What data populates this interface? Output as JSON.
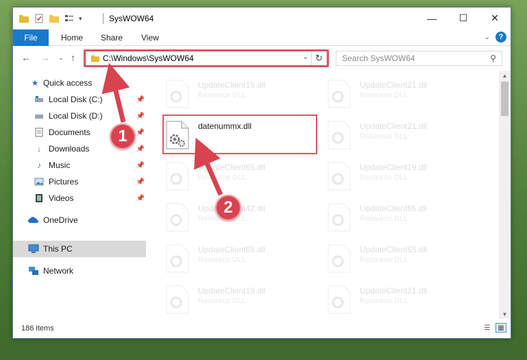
{
  "window": {
    "title": "SysWOW64",
    "controls": {
      "minimize": "—",
      "maximize": "☐",
      "close": "✕"
    }
  },
  "ribbon": {
    "tabs": [
      "File",
      "Home",
      "Share",
      "View"
    ]
  },
  "address": {
    "path": "C:\\Windows\\SysWOW64",
    "search_placeholder": "Search SysWOW64"
  },
  "navpane": {
    "items": [
      {
        "label": "Quick access",
        "icon": "star-icon"
      },
      {
        "label": "Local Disk (C:)",
        "icon": "drive-icon",
        "pinned": true
      },
      {
        "label": "Local Disk (D:)",
        "icon": "drive-icon",
        "pinned": true
      },
      {
        "label": "Documents",
        "icon": "documents-icon",
        "pinned": true
      },
      {
        "label": "Downloads",
        "icon": "download-icon",
        "pinned": true
      },
      {
        "label": "Music",
        "icon": "music-icon",
        "pinned": true
      },
      {
        "label": "Pictures",
        "icon": "pictures-icon",
        "pinned": true
      },
      {
        "label": "Videos",
        "icon": "videos-icon",
        "pinned": true
      },
      {
        "label": "OneDrive",
        "icon": "cloud-icon"
      },
      {
        "label": "This PC",
        "icon": "computer-icon",
        "selected": true
      },
      {
        "label": "Network",
        "icon": "network-icon"
      }
    ]
  },
  "files": {
    "highlighted": {
      "name": "datenummx.dll"
    },
    "faded": [
      {
        "name": "UpdateClient19.dll",
        "type": "Resource DLL"
      },
      {
        "name": "UpdateClient21.dll",
        "type": "Resource DLL"
      },
      {
        "name": "UpdateClient21.dll",
        "type": "Resource DLL"
      },
      {
        "name": "UpdateClient65.dll",
        "type": "Resource DLL"
      },
      {
        "name": "UpdateClient19.dll",
        "type": "Resource DLL"
      },
      {
        "name": "UpdateClient42.dll",
        "type": "Resource DLL"
      },
      {
        "name": "UpdateClient65.dll",
        "type": "Resource DLL"
      },
      {
        "name": "UpdateClient65.dll",
        "type": "Resource DLL"
      },
      {
        "name": "UpdateClient65.dll",
        "type": "Resource DLL"
      },
      {
        "name": "UpdateClient19.dll",
        "type": "Resource DLL"
      },
      {
        "name": "UpdateClient21.dll",
        "type": "Resource DLL"
      }
    ]
  },
  "status": {
    "item_count": "186 items"
  },
  "callouts": [
    "1",
    "2"
  ],
  "colors": {
    "accent": "#1979ca",
    "highlight": "#e05460"
  }
}
